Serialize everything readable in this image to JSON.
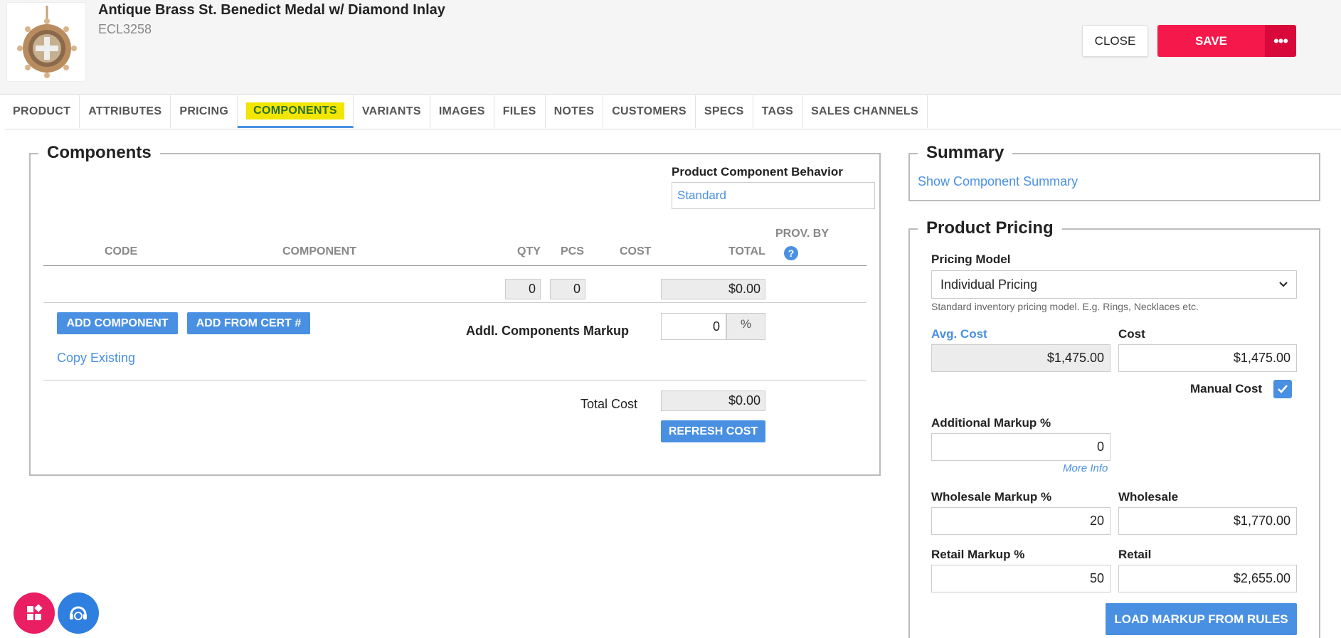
{
  "product": {
    "title": "Antique Brass St. Benedict Medal w/ Diamond Inlay",
    "sku": "ECL3258"
  },
  "actions": {
    "close": "CLOSE",
    "save": "SAVE",
    "more": "•••"
  },
  "tabs": [
    "PRODUCT",
    "ATTRIBUTES",
    "PRICING",
    "COMPONENTS",
    "VARIANTS",
    "IMAGES",
    "FILES",
    "NOTES",
    "CUSTOMERS",
    "SPECS",
    "TAGS",
    "SALES CHANNELS"
  ],
  "active_tab": "COMPONENTS",
  "components": {
    "legend": "Components",
    "behavior_label": "Product Component Behavior",
    "behavior_placeholder": "Standard",
    "columns": {
      "code": "CODE",
      "component": "COMPONENT",
      "qty": "QTY",
      "pcs": "PCS",
      "cost": "COST",
      "total": "TOTAL",
      "prov_by": "PROV. BY"
    },
    "totals_row": {
      "qty": "0",
      "pcs": "0",
      "total": "$0.00"
    },
    "add_component": "ADD COMPONENT",
    "add_from_cert": "ADD FROM CERT #",
    "copy_existing": "Copy Existing",
    "markup_label": "Addl. Components Markup",
    "markup_value": "0",
    "markup_unit": "%",
    "total_cost_label": "Total Cost",
    "total_cost_value": "$0.00",
    "refresh_cost": "REFRESH COST"
  },
  "summary": {
    "legend": "Summary",
    "link": "Show Component Summary"
  },
  "pricing": {
    "legend": "Product Pricing",
    "model_label": "Pricing Model",
    "model_value": "Individual Pricing",
    "model_help": "Standard inventory pricing model. E.g. Rings, Necklaces etc.",
    "avg_cost_label": "Avg. Cost",
    "avg_cost_value": "$1,475.00",
    "cost_label": "Cost",
    "cost_value": "$1,475.00",
    "manual_cost_label": "Manual Cost",
    "manual_cost_checked": true,
    "addl_markup_label": "Additional Markup %",
    "addl_markup_value": "0",
    "more_info": "More Info",
    "wholesale_markup_label": "Wholesale Markup %",
    "wholesale_markup_value": "20",
    "wholesale_label": "Wholesale",
    "wholesale_value": "$1,770.00",
    "retail_markup_label": "Retail Markup %",
    "retail_markup_value": "50",
    "retail_label": "Retail",
    "retail_value": "$2,655.00",
    "load_markup": "LOAD MARKUP FROM RULES"
  },
  "colors": {
    "accent": "#4a90e2",
    "save": "#f5184a",
    "tab_highlight": "#f2e600",
    "fab_pink": "#e91e63"
  }
}
